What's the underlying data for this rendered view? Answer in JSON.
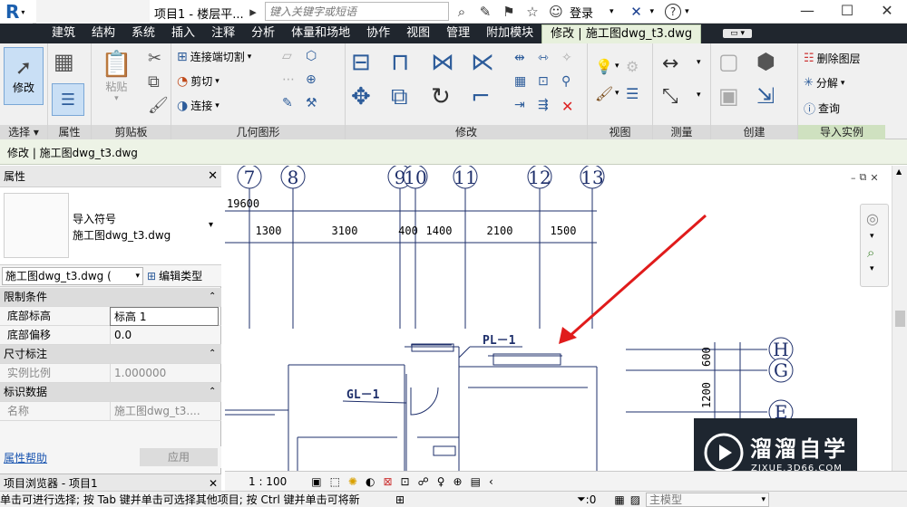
{
  "titlebar": {
    "doc_title": "项目1 - 楼层平...",
    "search_placeholder": "键入关键字或短语",
    "login_label": "登录",
    "app_letter": "R"
  },
  "menu": [
    "建筑",
    "结构",
    "系统",
    "插入",
    "注释",
    "分析",
    "体量和场地",
    "协作",
    "视图",
    "管理",
    "附加模块",
    "修改 | 施工图dwg_t3.dwg"
  ],
  "ribbon": {
    "select": {
      "modify_label": "修改",
      "panel": "选择"
    },
    "properties": {
      "panel": "属性"
    },
    "clipboard": {
      "paste": "粘贴",
      "panel": "剪贴板"
    },
    "geometry": {
      "items": [
        "连接端切割",
        "剪切",
        "连接"
      ],
      "panel": "几何图形"
    },
    "modify": {
      "panel": "修改"
    },
    "view": {
      "panel": "视图"
    },
    "measure": {
      "panel": "测量"
    },
    "create": {
      "panel": "创建"
    },
    "import": {
      "items": [
        "删除图层",
        "分解",
        "查询"
      ],
      "panel": "导入实例"
    }
  },
  "context_title": "修改 | 施工图dwg_t3.dwg",
  "properties": {
    "header": "属性",
    "type_name_line1": "导入符号",
    "type_name_line2": "施工图dwg_t3.dwg",
    "instance_select": "施工图dwg_t3.dwg (",
    "edit_type": "编辑类型",
    "sections": [
      {
        "title": "限制条件",
        "rows": [
          {
            "label": "底部标高",
            "value": "标高 1"
          },
          {
            "label": "底部偏移",
            "value": "0.0"
          }
        ]
      },
      {
        "title": "尺寸标注",
        "rows": [
          {
            "label": "实例比例",
            "value": "1.000000"
          }
        ]
      },
      {
        "title": "标识数据",
        "rows": [
          {
            "label": "名称",
            "value": "施工图dwg_t3...."
          }
        ]
      }
    ],
    "help_link": "属性帮助",
    "apply": "应用",
    "browser_title": "项目浏览器 - 项目1"
  },
  "drawing": {
    "grid_labels": [
      "7",
      "8",
      "9",
      "10",
      "11",
      "12",
      "13"
    ],
    "row_labels": [
      "H",
      "G",
      "E"
    ],
    "overall_dim": "19600",
    "dims": [
      "1300",
      "3100",
      "400",
      "1400",
      "2100",
      "1500"
    ],
    "vertical_dims": [
      "600",
      "1200"
    ],
    "tags": [
      "PL－1",
      "GL－1"
    ]
  },
  "view_control": {
    "scale": "1 : 100"
  },
  "statusbar": {
    "hint": "单击可进行选择; 按 Tab 键并单击可选择其他项目; 按 Ctrl 键并单击可将新",
    "filter_count": ":0",
    "model": "主模型"
  },
  "watermark": {
    "brand": "溜溜自学",
    "url": "ZIXUE.3D66.COM"
  },
  "colors": {
    "menubar": "#20262e",
    "drawing_line": "#1e2f6b",
    "arrow": "#e01b1b",
    "context": "#e7f0dc"
  }
}
